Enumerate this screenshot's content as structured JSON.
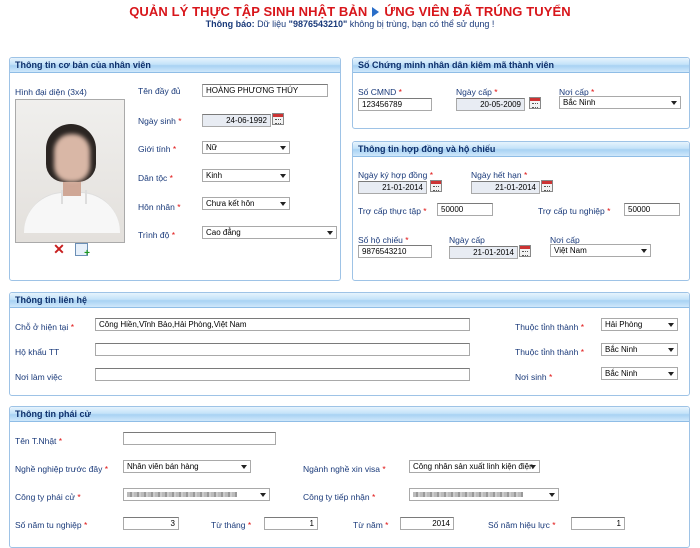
{
  "header": {
    "title_left": "QUẢN LÝ THỰC TẬP SINH NHẬT BẢN",
    "title_right": "ỨNG VIÊN ĐÃ TRÚNG TUYỂN",
    "notice_label": "Thông báo:",
    "notice_pre": "Dữ liệu",
    "notice_value": "\"9876543210\"",
    "notice_post": "không bị trùng, bạn có thể sử dụng !"
  },
  "basic": {
    "heading": "Thông tin cơ bản của nhân viên",
    "photo_label": "Hình đại diện (3x4)",
    "fullname_label": "Tên đầy đủ",
    "fullname_value": "HOÀNG PHƯƠNG THÚY",
    "dob_label": "Ngày sinh",
    "dob_value": "24-06-1992",
    "gender_label": "Giới tính",
    "gender_value": "Nữ",
    "ethnic_label": "Dân tộc",
    "ethnic_value": "Kinh",
    "marital_label": "Hôn nhân",
    "marital_value": "Chưa kết hôn",
    "education_label": "Trình độ",
    "education_value": "Cao đẳng"
  },
  "idcard": {
    "heading": "Số Chứng minh nhân dân kiêm mã thành viên",
    "number_label": "Số CMND",
    "number_value": "123456789",
    "issue_date_label": "Ngày cấp",
    "issue_date_value": "20-05-2009",
    "issue_place_label": "Nơi cấp",
    "issue_place_value": "Bắc Ninh"
  },
  "contract": {
    "heading": "Thông tin hợp đồng và hộ chiếu",
    "sign_date_label": "Ngày ký hợp đồng",
    "sign_date_value": "21-01-2014",
    "expiry_label": "Ngày hết hạn",
    "expiry_value": "21-01-2014",
    "intern_allow_label": "Trợ cấp thực tập",
    "intern_allow_value": "50000",
    "grad_allow_label": "Trợ cấp tu nghiệp",
    "grad_allow_value": "50000",
    "passport_label": "Số hộ chiếu",
    "passport_value": "9876543210",
    "pp_date_label": "Ngày cấp",
    "pp_date_value": "21-01-2014",
    "pp_place_label": "Nơi cấp",
    "pp_place_value": "Việt Nam"
  },
  "contact": {
    "heading": "Thông tin liên hệ",
    "current_addr_label": "Chỗ ở hiện tại",
    "current_addr_value": "Công Hiền,Vĩnh Bảo,Hải Phòng,Việt Nam",
    "household_label": "Hộ khẩu TT",
    "household_value": "",
    "workplace_label": "Nơi làm việc",
    "workplace_value": "",
    "province1_label": "Thuộc tỉnh thành",
    "province1_value": "Hải Phòng",
    "province2_label": "Thuộc tỉnh thành",
    "province2_value": "Bắc Ninh",
    "birthplace_label": "Nơi sinh",
    "birthplace_value": "Bắc Ninh"
  },
  "dispatch": {
    "heading": "Thông tin phái cử",
    "jp_name_label": "Tên T.Nhật",
    "jp_name_value": "",
    "prev_job_label": "Nghề nghiệp trước đây",
    "prev_job_value": "Nhân viên bán hàng",
    "visa_job_label": "Ngành nghề xin visa",
    "visa_job_value": "Công nhân sản xuất linh kiện điện",
    "dispatch_co_label": "Công ty phái cử",
    "receive_co_label": "Công ty tiếp nhận",
    "years_label": "Số năm tu nghiệp",
    "years_value": "3",
    "from_month_label": "Từ tháng",
    "from_month_value": "1",
    "from_year_label": "Từ năm",
    "from_year_value": "2014",
    "valid_years_label": "Số năm hiệu lực",
    "valid_years_value": "1"
  },
  "colors": {
    "title": "#d8161b",
    "label": "#1a3a7a",
    "required": "#e01010",
    "panel_border": "#9ec3e6"
  },
  "icons": [
    "arrow-right-icon",
    "calendar-icon",
    "delete-icon",
    "add-photo-icon"
  ]
}
